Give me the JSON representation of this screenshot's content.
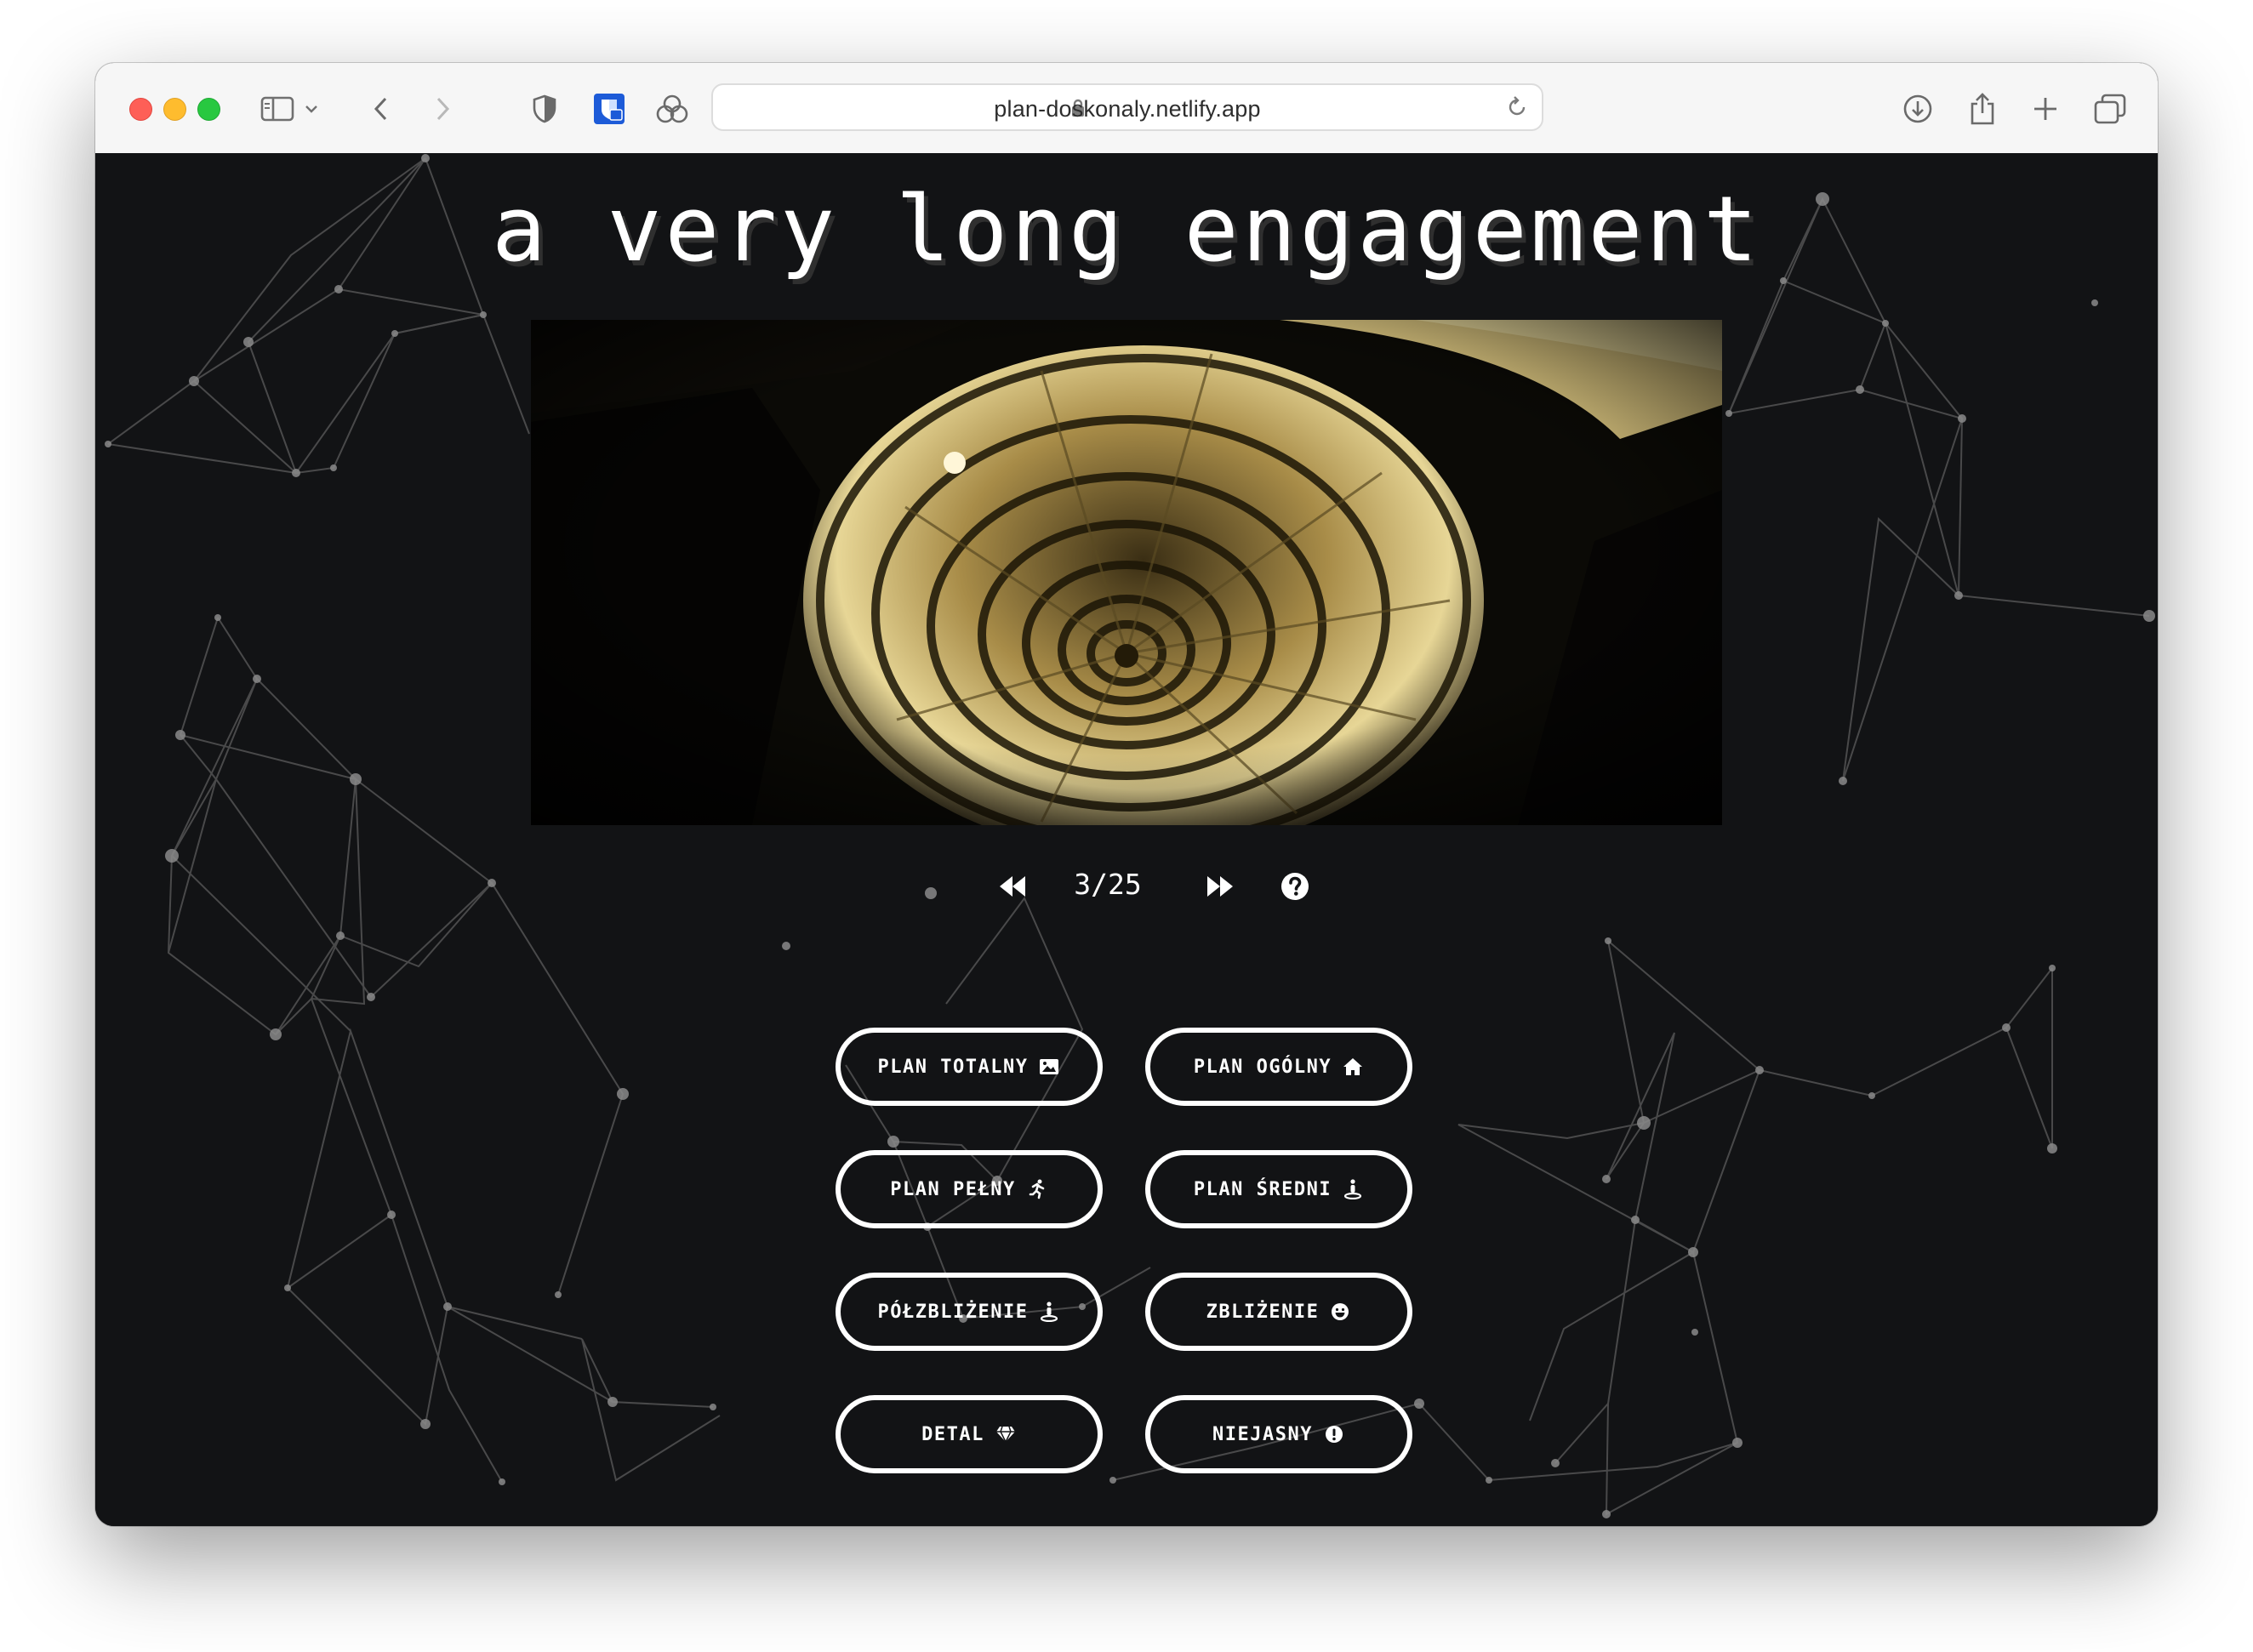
{
  "browser": {
    "url": "plan-doskonaly.netlify.app",
    "icons": [
      "sidebar-icon",
      "chevron-down-icon",
      "back-icon",
      "forward-icon",
      "shield-icon",
      "bitwarden-icon",
      "extension-icon",
      "lock-icon",
      "reload-icon",
      "download-icon",
      "share-icon",
      "new-tab-icon",
      "tab-overview-icon"
    ]
  },
  "page": {
    "title": "a very long engagement",
    "image_alt_subject": "spiral staircase viewed from above",
    "counter": "3/25",
    "nav_icons": [
      "rewind-icon",
      "fast-forward-icon",
      "help-icon"
    ],
    "buttons": [
      {
        "label": "PLAN TOTALNY",
        "icon": "image-icon"
      },
      {
        "label": "PLAN OGÓLNY",
        "icon": "home-icon"
      },
      {
        "label": "PLAN PEŁNY",
        "icon": "running-person-icon"
      },
      {
        "label": "PLAN ŚREDNI",
        "icon": "standing-person-icon"
      },
      {
        "label": "PÓŁZBLIŻENIE",
        "icon": "standing-person-icon"
      },
      {
        "label": "ZBLIŻENIE",
        "icon": "smile-icon"
      },
      {
        "label": "DETAL",
        "icon": "gem-icon"
      },
      {
        "label": "NIEJASNY",
        "icon": "exclamation-circle-icon"
      }
    ]
  },
  "colors": {
    "background": "#121315",
    "text": "#ffffff",
    "network_lines": "#6a6a6a",
    "image_tone": "#d8c27a"
  }
}
